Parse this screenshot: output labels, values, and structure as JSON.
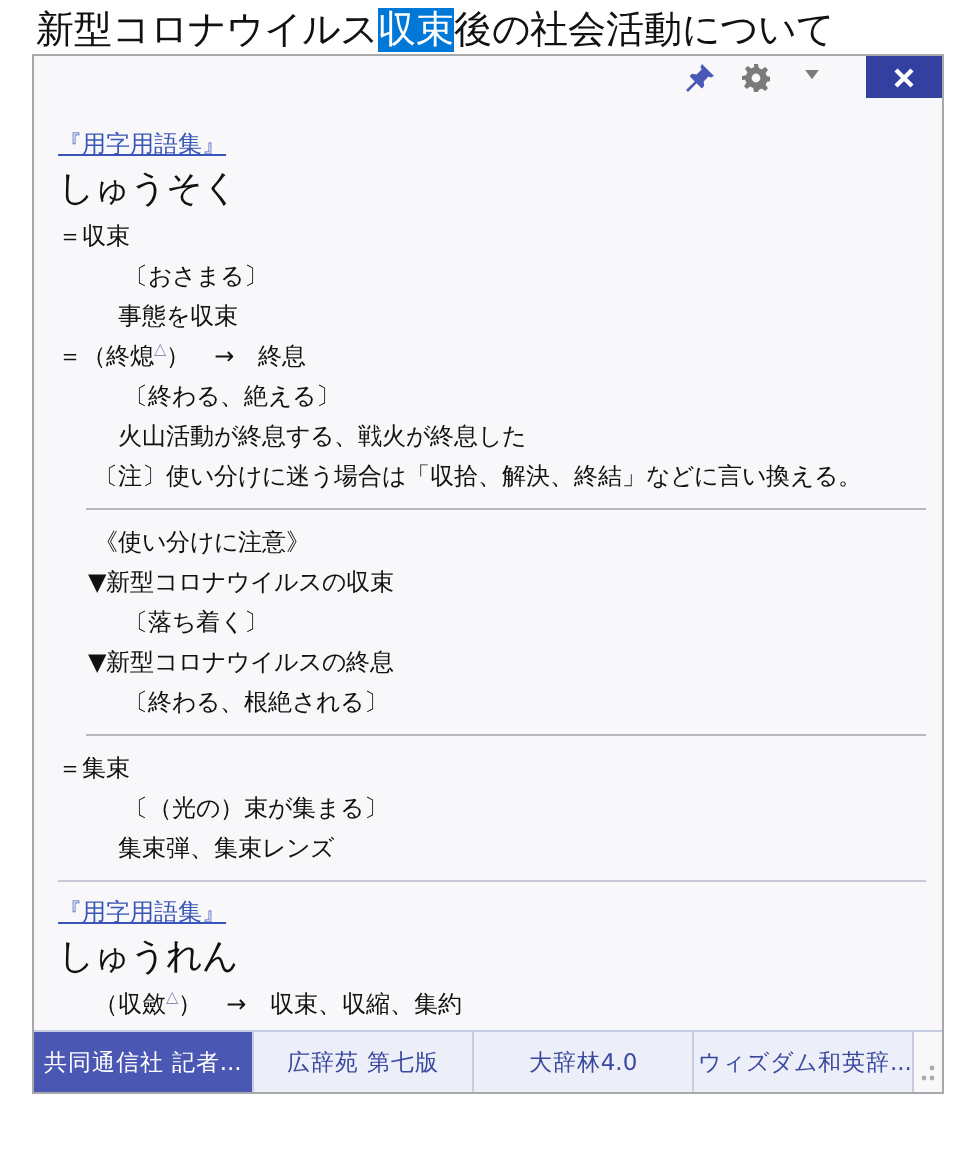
{
  "heading": {
    "segments": [
      {
        "text": "新型コロナウイルス",
        "selected": false
      },
      {
        "text": "収束",
        "selected": true
      },
      {
        "text": "後の社会活動について",
        "selected": false
      }
    ]
  },
  "popup": {
    "pinned": true,
    "entries": [
      {
        "kind": "source",
        "text": "『用字用語集』"
      },
      {
        "kind": "reading",
        "text": "しゅうそく"
      },
      {
        "kind": "head",
        "text": "＝収束"
      },
      {
        "kind": "gloss",
        "text": "〔おさまる〕"
      },
      {
        "kind": "example",
        "text": "事態を収束"
      },
      {
        "kind": "head",
        "text": "＝（終熄$^{△}$）　→　終息"
      },
      {
        "kind": "gloss",
        "text": "〔終わる、絶える〕"
      },
      {
        "kind": "example",
        "text": "火山活動が終息する、戦火が終息した"
      },
      {
        "kind": "note",
        "text": "〔注〕使い分けに迷う場合は「収拾、解決、終結」などに言い換える。"
      },
      {
        "kind": "divider"
      },
      {
        "kind": "note",
        "text": "《使い分けに注意》"
      },
      {
        "kind": "bullet",
        "text": "▼新型コロナウイルスの収束"
      },
      {
        "kind": "gloss",
        "text": "〔落ち着く〕"
      },
      {
        "kind": "bullet",
        "text": "▼新型コロナウイルスの終息"
      },
      {
        "kind": "gloss",
        "text": "〔終わる、根絶される〕"
      },
      {
        "kind": "divider"
      },
      {
        "kind": "head",
        "text": "＝集束"
      },
      {
        "kind": "gloss",
        "text": "〔（光の）束が集まる〕"
      },
      {
        "kind": "example",
        "text": "集束弾、集束レンズ"
      },
      {
        "kind": "separator"
      },
      {
        "kind": "source",
        "text": "『用字用語集』"
      },
      {
        "kind": "reading",
        "text": "しゅうれん"
      },
      {
        "kind": "note",
        "text": "（収斂$^{△}$）　→　収束、収縮、集約"
      }
    ],
    "tabs": [
      {
        "label": "共同通信社 記者...",
        "selected": true
      },
      {
        "label": "広辞苑 第七版",
        "selected": false
      },
      {
        "label": "大辞林4.0",
        "selected": false
      },
      {
        "label": "ウィズダム和英辞...",
        "selected": false
      }
    ]
  }
}
